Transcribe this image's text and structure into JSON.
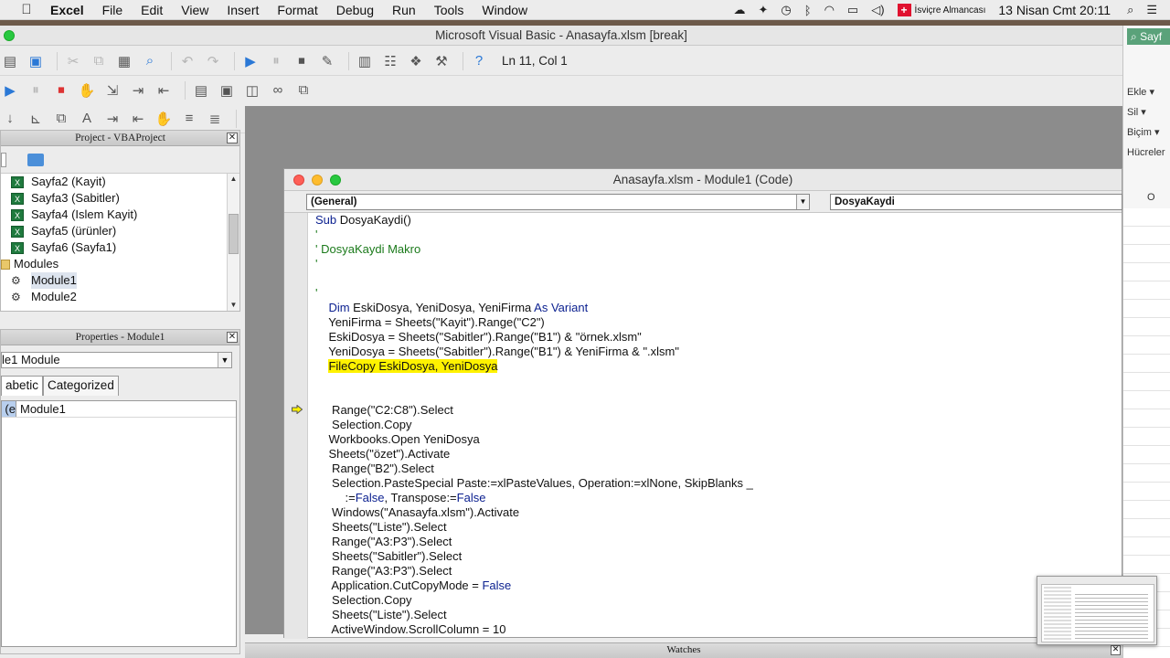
{
  "menubar": {
    "app": "Excel",
    "items": [
      "File",
      "Edit",
      "View",
      "Insert",
      "Format",
      "Debug",
      "Run",
      "Tools",
      "Window"
    ],
    "keyboard_layout": "İsviçre Almancası",
    "clock": "13 Nisan Cmt  20:11"
  },
  "vbe": {
    "title": "Microsoft Visual Basic - Anasayfa.xlsm [break]",
    "status": "Ln 11, Col 1"
  },
  "project": {
    "title": "Project - VBAProject",
    "items": [
      {
        "label": "Sayfa2 (Kayit)",
        "type": "sheet"
      },
      {
        "label": "Sayfa3 (Sabitler)",
        "type": "sheet"
      },
      {
        "label": "Sayfa4 (Islem Kayit)",
        "type": "sheet"
      },
      {
        "label": "Sayfa5 (ürünler)",
        "type": "sheet"
      },
      {
        "label": "Sayfa6 (Sayfa1)",
        "type": "sheet"
      },
      {
        "label": "Modules",
        "type": "folder"
      },
      {
        "label": "Module1",
        "type": "module"
      },
      {
        "label": "Module2",
        "type": "module"
      }
    ]
  },
  "properties": {
    "title": "Properties - Module1",
    "object": "le1 Module",
    "tabs": [
      "abetic",
      "Categorized"
    ],
    "rows": [
      {
        "name": "e)",
        "value": "Module1"
      }
    ]
  },
  "code_window": {
    "title": "Anasayfa.xlsm - Module1 (Code)",
    "object_combo": "(General)",
    "proc_combo": "DosyaKaydi",
    "lines": [
      [
        {
          "t": "Sub ",
          "c": "kw"
        },
        {
          "t": "DosyaKaydi()"
        }
      ],
      [
        {
          "t": "'",
          "c": "cm"
        }
      ],
      [
        {
          "t": "' DosyaKaydi Makro",
          "c": "cm"
        }
      ],
      [
        {
          "t": "'",
          "c": "cm"
        }
      ],
      [],
      [
        {
          "t": "'",
          "c": "cm"
        }
      ],
      [
        {
          "t": "    "
        },
        {
          "t": "Dim ",
          "c": "kw"
        },
        {
          "t": "EskiDosya, YeniDosya, YeniFirma "
        },
        {
          "t": "As Variant",
          "c": "kw"
        }
      ],
      [
        {
          "t": "    YeniFirma = Sheets(\"Kayit\").Range(\"C2\")"
        }
      ],
      [
        {
          "t": "    EskiDosya = Sheets(\"Sabitler\").Range(\"B1\") & \"örnek.xlsm\""
        }
      ],
      [
        {
          "t": "    YeniDosya = Sheets(\"Sabitler\").Range(\"B1\") & YeniFirma & \".xlsm\""
        }
      ],
      [
        {
          "t": "    "
        },
        {
          "t": "FileCopy EskiDosya, YeniDosya",
          "c": "hl"
        }
      ],
      [],
      [],
      [
        {
          "t": "     Range(\"C2:C8\").Select"
        }
      ],
      [
        {
          "t": "     Selection.Copy"
        }
      ],
      [
        {
          "t": "    Workbooks.Open YeniDosya"
        }
      ],
      [
        {
          "t": "    Sheets(\"özet\").Activate"
        }
      ],
      [
        {
          "t": "     Range(\"B2\").Select"
        }
      ],
      [
        {
          "t": "     Selection.PasteSpecial Paste:=xlPasteValues, Operation:=xlNone, SkipBlanks _"
        }
      ],
      [
        {
          "t": "         :="
        },
        {
          "t": "False",
          "c": "kw"
        },
        {
          "t": ", Transpose:="
        },
        {
          "t": "False",
          "c": "kw"
        }
      ],
      [
        {
          "t": "     Windows(\"Anasayfa.xlsm\").Activate"
        }
      ],
      [
        {
          "t": "     Sheets(\"Liste\").Select"
        }
      ],
      [
        {
          "t": "     Range(\"A3:P3\").Select"
        }
      ],
      [
        {
          "t": "     Sheets(\"Sabitler\").Select"
        }
      ],
      [
        {
          "t": "     Range(\"A3:P3\").Select"
        }
      ],
      [
        {
          "t": "     Application.CutCopyMode = "
        },
        {
          "t": "False",
          "c": "kw"
        }
      ],
      [
        {
          "t": "     Selection.Copy"
        }
      ],
      [
        {
          "t": "     Sheets(\"Liste\").Select"
        }
      ],
      [
        {
          "t": "     ActiveWindow.ScrollColumn = 10"
        }
      ]
    ]
  },
  "watches": {
    "title": "Watches"
  },
  "excel_side": {
    "search": "Sayf",
    "items": [
      "Ekle",
      "Sil",
      "Biçim",
      "Hücreler"
    ],
    "cell": "O"
  }
}
